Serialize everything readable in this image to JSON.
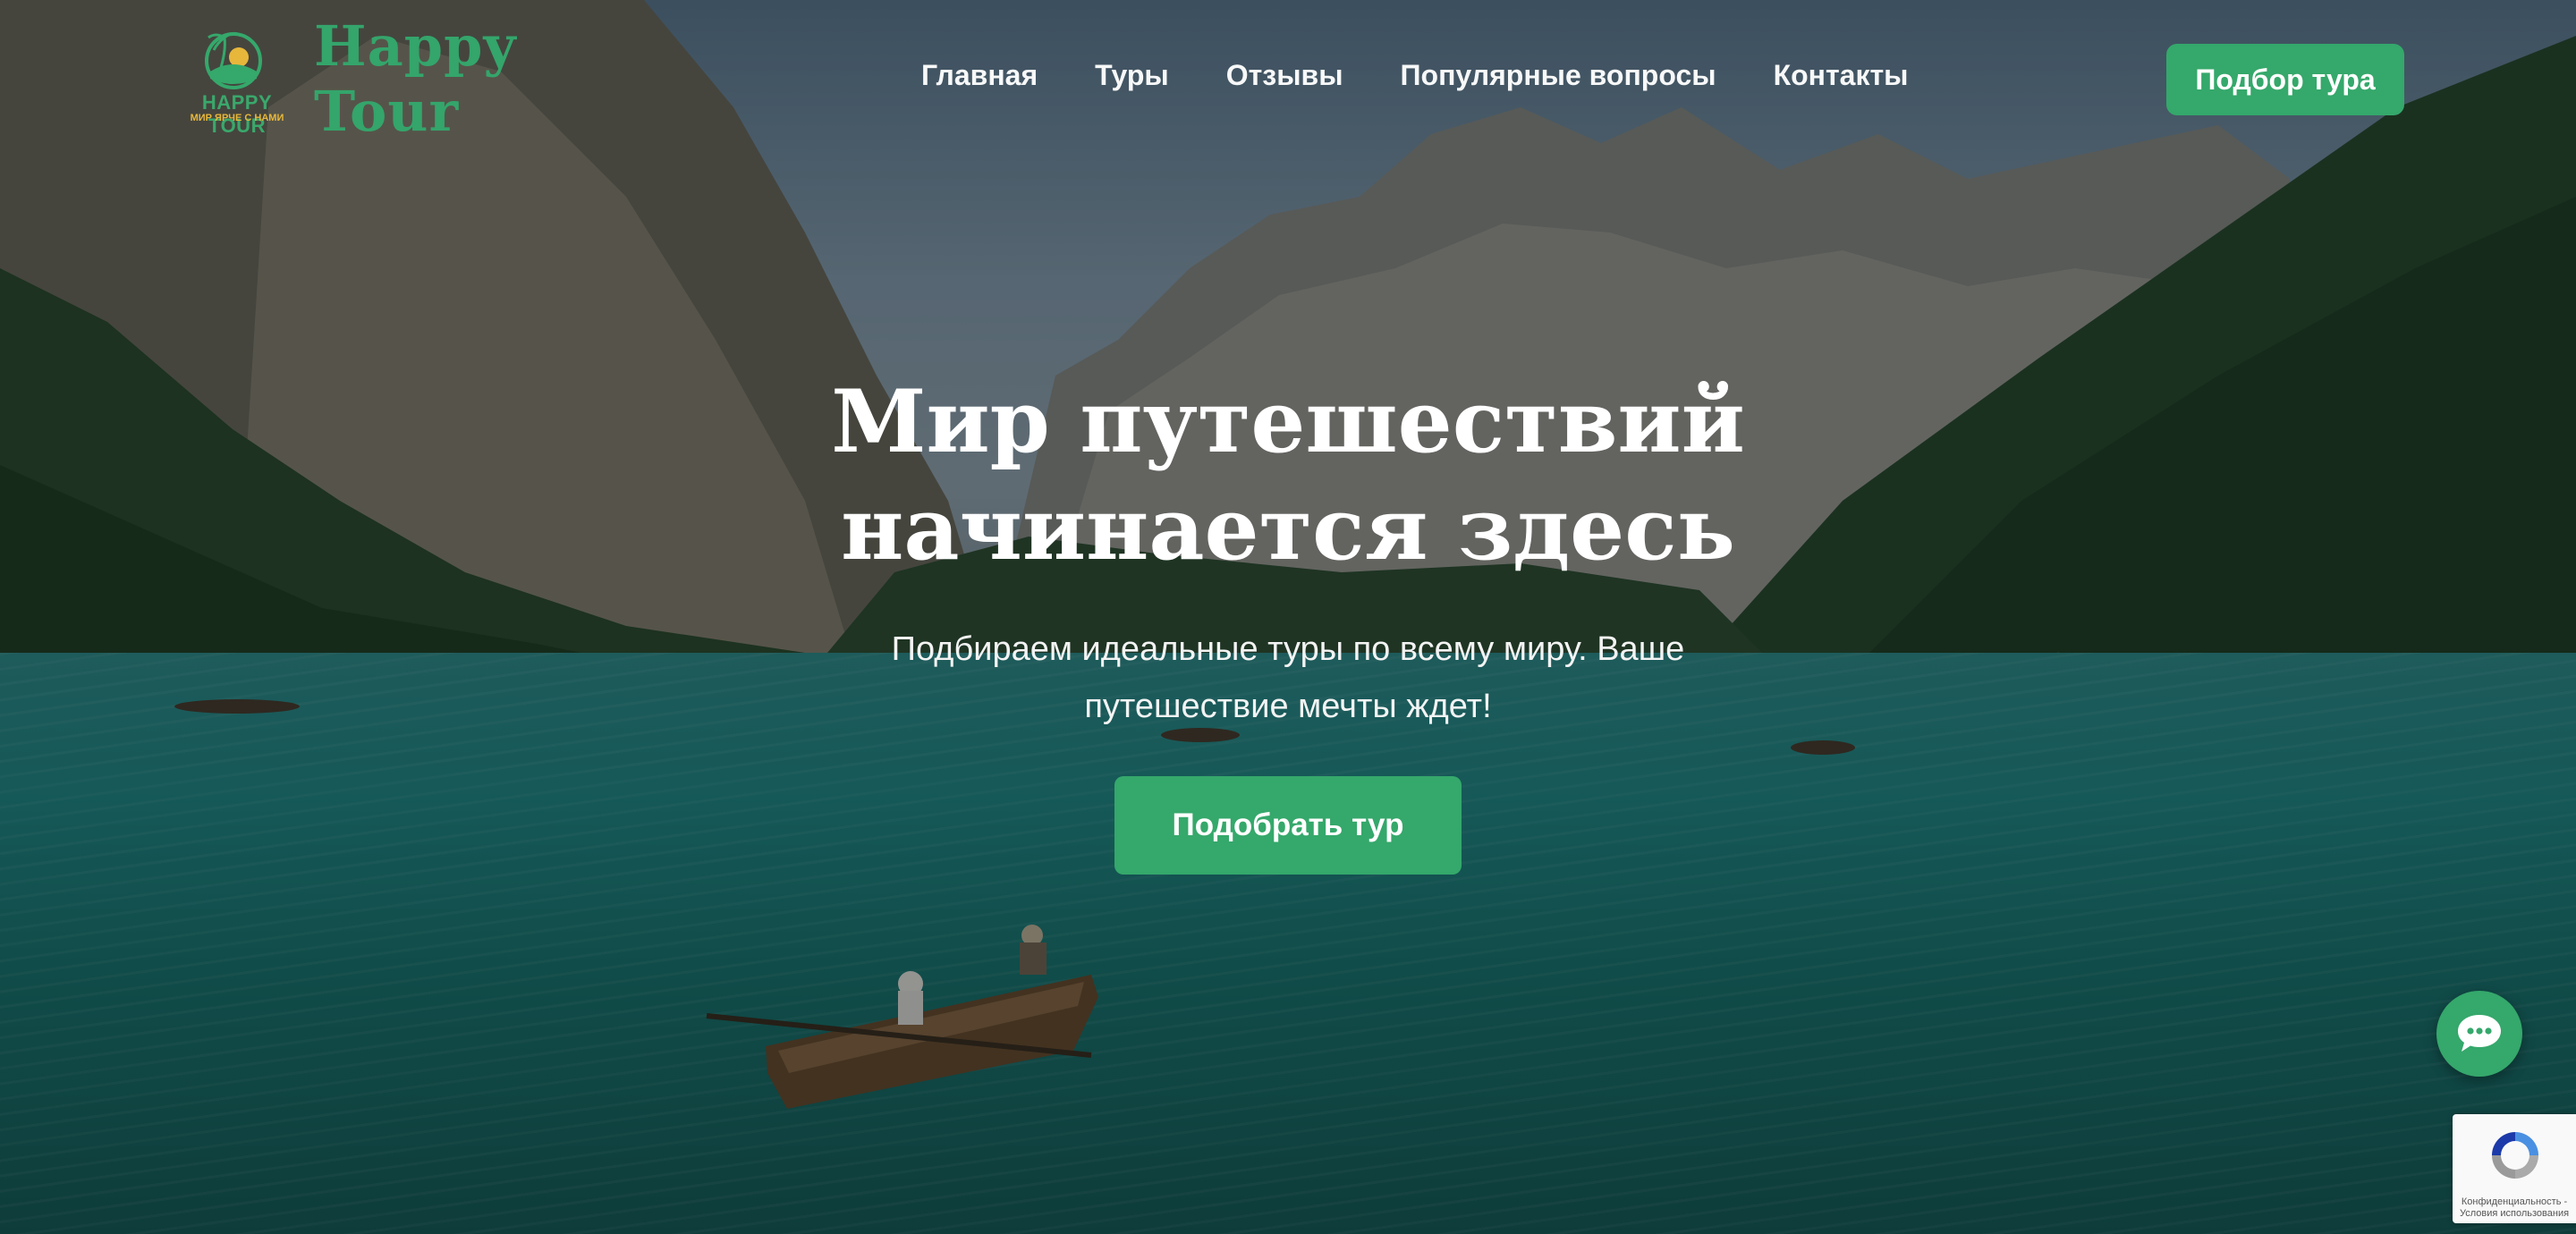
{
  "brand": {
    "emblem_name": "HAPPY TOUR",
    "emblem_tagline": "МИР ЯРЧЕ С НАМИ",
    "name": "Happy Tour"
  },
  "nav": {
    "items": [
      "Главная",
      "Туры",
      "Отзывы",
      "Популярные вопросы",
      "Контакты"
    ]
  },
  "header": {
    "cta_label": "Подбор тура"
  },
  "hero": {
    "title_line1": "Мир путешествий",
    "title_line2": "начинается здесь",
    "subtitle_line1": "Подбираем идеальные туры по всему миру. Ваше",
    "subtitle_line2": "путешествие мечты ждет!",
    "cta_label": "Подобрать тур"
  },
  "recaptcha": {
    "text": "Конфиденциальность - Условия использования"
  },
  "colors": {
    "accent": "#35a86b",
    "logo_text": "#34a56b",
    "tagline": "#e7b73b"
  },
  "icons": [
    "chat-icon",
    "palm-sun-emblem-icon",
    "recaptcha-icon"
  ]
}
